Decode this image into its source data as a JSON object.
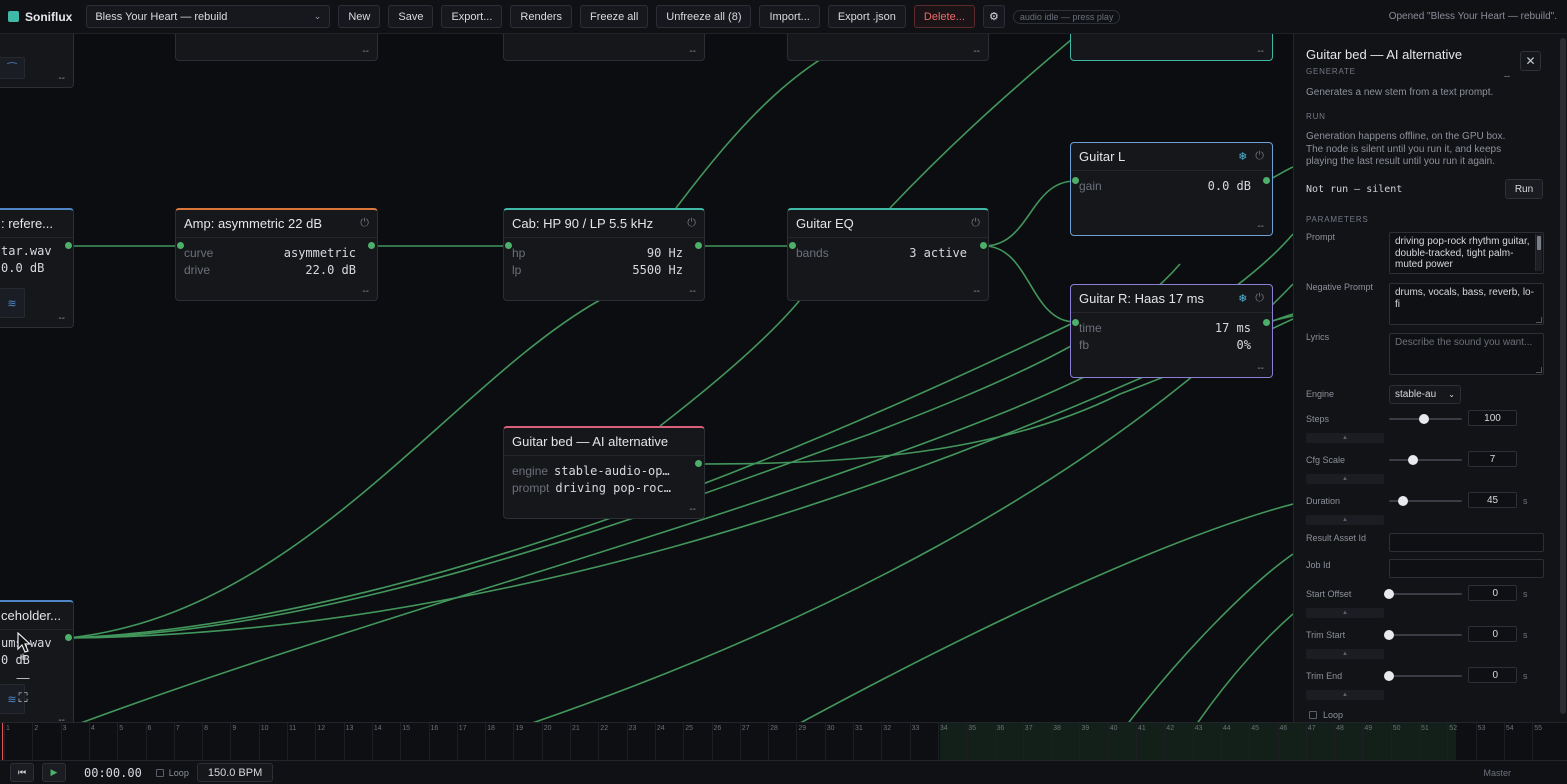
{
  "app": {
    "name": "Soniflux"
  },
  "toolbar": {
    "project": "Bless Your Heart — rebuild",
    "new": "New",
    "save": "Save",
    "export": "Export...",
    "renders": "Renders",
    "freeze_all": "Freeze all",
    "unfreeze_all": "Unfreeze all (8)",
    "import": "Import...",
    "export_json": "Export .json",
    "delete": "Delete...",
    "gear": "⚙",
    "audio_status": "audio idle — press play",
    "status_message": "Opened \"Bless Your Heart — rebuild\"."
  },
  "nodes": {
    "top1": {
      "foot": "--"
    },
    "top2": {
      "foot": "--"
    },
    "top3": {
      "foot": "--"
    },
    "top4": {
      "foot": "--"
    },
    "top5": {
      "foot": "--"
    },
    "source": {
      "title": ": refere...",
      "file": "tar.wav",
      "gain": "0.0 dB",
      "foot": "--"
    },
    "amp": {
      "title": "Amp: asymmetric 22 dB",
      "k1": "curve",
      "v1": "asymmetric",
      "k2": "drive",
      "v2": "22.0 dB",
      "foot": "--"
    },
    "cab": {
      "title": "Cab: HP 90 / LP 5.5 kHz",
      "k1": "hp",
      "v1": "90 Hz",
      "k2": "lp",
      "v2": "5500 Hz",
      "foot": "--"
    },
    "eq": {
      "title": "Guitar EQ",
      "k1": "bands",
      "v1": "3 active",
      "foot": "--"
    },
    "guitar_l": {
      "title": "Guitar L",
      "k1": "gain",
      "v1": "0.0 dB",
      "foot": "--"
    },
    "guitar_r": {
      "title": "Guitar R: Haas 17 ms",
      "k1": "time",
      "v1": "17 ms",
      "k2": "fb",
      "v2": "0%",
      "foot": "--"
    },
    "bed": {
      "title": "Guitar bed — AI alternative",
      "k1": "engine",
      "v1": "stable-audio-op…",
      "k2": "prompt",
      "v2": "driving pop-roc…",
      "foot": "--"
    },
    "placeholder": {
      "title": "ceholder...",
      "file": "ums.wav",
      "gain": "0 dB",
      "foot": "--"
    }
  },
  "icons": {
    "power": "⏻",
    "snowflake": "❄"
  },
  "colors": {
    "accent_teal": "#3fb8a8",
    "wire_green": "#4caf6a",
    "amp_border": "#d9773a",
    "cab_border": "#3fb8a8",
    "eq_border": "#3fb8a8",
    "source_border": "#4f86c6",
    "guitar_l_border": "#6fa0d8",
    "guitar_r_border": "#8d7fd6",
    "bed_border": "#d9607a",
    "danger": "#ef6b6b"
  },
  "panel": {
    "title": "Guitar bed — AI alternative",
    "subtitle": "GENERATE",
    "dash": "--",
    "description": "Generates a new stem from a text prompt.",
    "run_section": "RUN",
    "run_note_1": "Generation happens offline, on the GPU box.",
    "run_note_2": "The node is silent until you run it, and keeps",
    "run_note_3": "playing the last result until you run it again.",
    "run_status": "Not run — silent",
    "run_button": "Run",
    "parameters_section": "PARAMETERS",
    "prompt_label": "Prompt",
    "prompt_value": "driving pop-rock rhythm guitar, double-tracked, tight palm-muted power",
    "negative_label": "Negative Prompt",
    "negative_value": "drums, vocals, bass, reverb, lo-fi",
    "lyrics_label": "Lyrics",
    "lyrics_placeholder": "Describe the sound you want...",
    "engine_label": "Engine",
    "engine_value": "stable-au",
    "steps_label": "Steps",
    "steps_value": "100",
    "steps_level": 0.48,
    "cfg_label": "Cfg Scale",
    "cfg_value": "7",
    "cfg_level": 0.33,
    "duration_label": "Duration",
    "duration_value": "45",
    "duration_unit": "s",
    "duration_level": 0.19,
    "result_label": "Result Asset Id",
    "job_label": "Job Id",
    "start_offset_label": "Start Offset",
    "start_offset_value": "0",
    "start_offset_unit": "s",
    "trim_start_label": "Trim Start",
    "trim_start_value": "0",
    "trim_start_unit": "s",
    "trim_end_label": "Trim End",
    "trim_end_value": "0",
    "trim_end_unit": "s",
    "bar_glyph": "▲",
    "loop_label": "Loop"
  },
  "zoom": {
    "plus": "+",
    "minus": "—",
    "fit": "⛶"
  },
  "timeline": {
    "markers": [
      "1",
      "2",
      "3",
      "4",
      "5",
      "6",
      "7",
      "8",
      "9",
      "10",
      "11",
      "12",
      "13",
      "14",
      "15",
      "16",
      "17",
      "18",
      "19",
      "20",
      "21",
      "22",
      "23",
      "24",
      "25",
      "26",
      "27",
      "28",
      "29",
      "30",
      "31",
      "32",
      "33",
      "34",
      "35",
      "36",
      "37",
      "38",
      "39",
      "40",
      "41",
      "42",
      "43",
      "44",
      "45",
      "46",
      "47",
      "48",
      "49",
      "50",
      "51",
      "52",
      "53",
      "54",
      "55"
    ]
  },
  "transport": {
    "rewind": "⏮",
    "play": "▶",
    "time": "00:00.00",
    "loop": "Loop",
    "bpm": "150.0 BPM",
    "master": "Master"
  }
}
